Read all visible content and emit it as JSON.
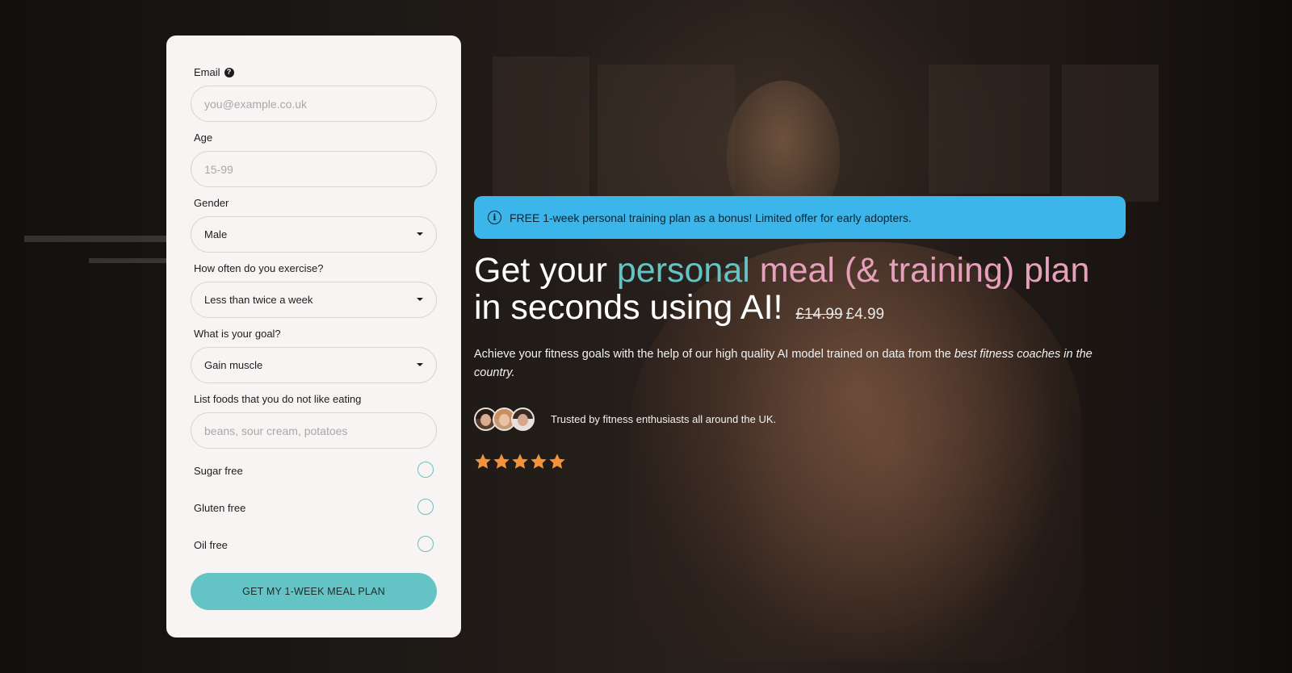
{
  "form": {
    "email": {
      "label": "Email",
      "placeholder": "you@example.co.uk"
    },
    "age": {
      "label": "Age",
      "placeholder": "15-99"
    },
    "gender": {
      "label": "Gender",
      "value": "Male"
    },
    "exercise": {
      "label": "How often do you exercise?",
      "value": "Less than twice a week"
    },
    "goal": {
      "label": "What is your goal?",
      "value": "Gain muscle"
    },
    "dislikes": {
      "label": "List foods that you do not like eating",
      "placeholder": "beans, sour cream, potatoes"
    },
    "options": [
      {
        "label": "Sugar free",
        "checked": false
      },
      {
        "label": "Gluten free",
        "checked": false
      },
      {
        "label": "Oil free",
        "checked": false
      }
    ],
    "submit_label": "GET MY 1-WEEK MEAL PLAN"
  },
  "banner": {
    "text": "FREE 1-week personal training plan as a bonus! Limited offer for early adopters.",
    "icon": "info-icon"
  },
  "hero": {
    "headline_part1": "Get your ",
    "headline_teal": "personal",
    "headline_pink": " meal (& training) plan",
    "headline_part2": "in seconds using AI!",
    "old_price": "£14.99",
    "new_price": "£4.99",
    "subcopy_plain": "Achieve your fitness goals with the help of our high quality AI model trained on data from the ",
    "subcopy_italic": "best fitness coaches in the country."
  },
  "trust": {
    "text": "Trusted by fitness enthusiasts all around the UK.",
    "avatar_count": 3
  },
  "rating": {
    "stars": 5,
    "max": 5
  },
  "colors": {
    "accent_teal": "#64c3c4",
    "accent_pink": "#e6a0bb",
    "banner_blue": "#3bb5ea",
    "star_orange": "#f2933c",
    "card_bg": "#f8f4f3"
  }
}
